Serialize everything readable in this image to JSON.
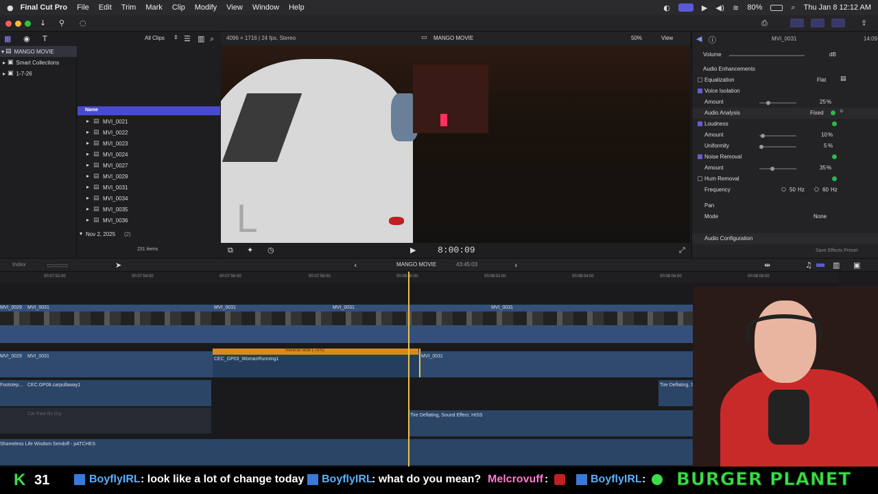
{
  "menubar": {
    "app_name": "Final Cut Pro",
    "items": [
      "File",
      "Edit",
      "Trim",
      "Mark",
      "Clip",
      "Modify",
      "View",
      "Window",
      "Help"
    ],
    "battery": "80%",
    "datetime": "Thu Jan 8  12:12 AM"
  },
  "browser": {
    "library_name": "MANGO MOVIE",
    "sidebar_items": [
      "Smart Collections",
      "1-7-26"
    ],
    "filter_label": "All Clips",
    "column_header": "Name",
    "clips": [
      "MVI_0021",
      "MVI_0022",
      "MVI_0023",
      "MVI_0024",
      "MVI_0027",
      "MVI_0029",
      "MVI_0031",
      "MVI_0034",
      "MVI_0035",
      "MVI_0036"
    ],
    "group_date": "Nov 2, 2025",
    "group_count": "(2)",
    "item_count": "231 items"
  },
  "viewer": {
    "format": "4096 × 1716 | 24 fps, Stereo",
    "title": "MANGO MOVIE",
    "zoom": "50%",
    "view_label": "View",
    "timecode": "8:00:09",
    "overlay_letter": "L"
  },
  "inspector": {
    "clip_name": "MVI_0031",
    "duration": "14:09",
    "volume_label": "Volume",
    "volume_unit": "dB",
    "section": "Audio Enhancements",
    "equalization": {
      "label": "Equalization",
      "value": "Flat"
    },
    "voice_isolation": {
      "label": "Voice Isolation",
      "amount_label": "Amount",
      "amount": "25",
      "unit": "%"
    },
    "audio_analysis": {
      "label": "Audio Analysis",
      "value": "Fixed"
    },
    "loudness": {
      "label": "Loudness",
      "amount_label": "Amount",
      "amount": "10",
      "uniformity_label": "Uniformity",
      "uniformity": "5",
      "unit": "%"
    },
    "noise_removal": {
      "label": "Noise Removal",
      "amount_label": "Amount",
      "amount": "35",
      "unit": "%"
    },
    "hum_removal": {
      "label": "Hum Removal",
      "frequency_label": "Frequency",
      "f1": "50",
      "f2": "60",
      "unit": "Hz"
    },
    "pan": {
      "label": "Pan",
      "mode_label": "Mode",
      "mode": "None"
    },
    "audio_config": "Audio Configuration",
    "save_preset": "Save Effects Preset"
  },
  "timeline": {
    "index_label": "Index",
    "project_title": "MANGO MOVIE",
    "project_duration": "43:45:03",
    "ruler_ticks": [
      "00:07:52:00",
      "00:07:54:00",
      "00:07:56:00",
      "00:07:58:00",
      "00:08:00:00",
      "00:08:02:00",
      "00:08:04:00",
      "00:08:06:00",
      "00:08:08:00"
    ],
    "video_clips": [
      "MVI_0029",
      "MVI_0031",
      "MVI_0031",
      "MVI_0031",
      "MVI_0031"
    ],
    "audio_clips": [
      "MVI_0029",
      "MVI_0031",
      "CEC_GP03_WomanRunning1",
      "MVI_0031"
    ],
    "retime_label": "Reverse Slow (-75%)",
    "sfx_clips": [
      "Footstep...",
      "CEC.GP08.carpullaway1",
      "Car Fast By Dry",
      "Tire Deflating, Sound Effect, HISS",
      "Tire Deflating, Sound Effect, HISS"
    ],
    "music_clip": "Shameless Life Wisdom Sendoff - pATCHES"
  },
  "chat": {
    "count": "31",
    "messages": [
      {
        "user": "BoyflyIRL",
        "text": ": look like a lot of change today"
      },
      {
        "user": "BoyflyIRL",
        "text": ": what do you mean?"
      },
      {
        "user": "Melcrovuff",
        "text": ":"
      },
      {
        "user": "BoyflyIRL",
        "text": ":"
      }
    ],
    "brand": "BURGER PLANET"
  },
  "colors": {
    "accent": "#5a5ad6",
    "clip_blue": "#34507a",
    "retime_orange": "#d98a1e",
    "playhead": "#e8c44a",
    "check_purple": "#6b5cd6"
  }
}
